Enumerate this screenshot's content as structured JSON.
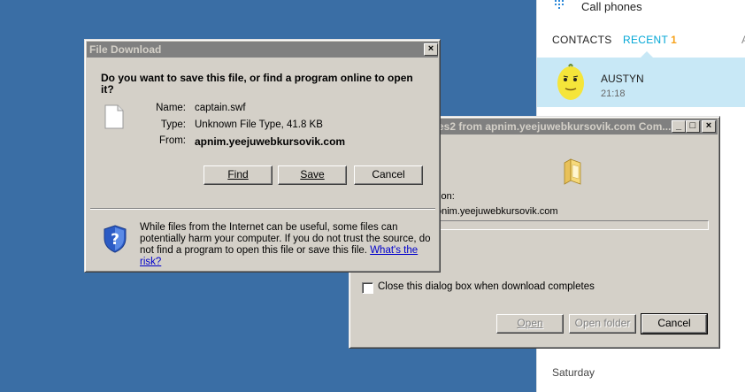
{
  "skype": {
    "call_label": "Call phones",
    "tabs": {
      "contacts": "CONTACTS",
      "recent": "RECENT",
      "recent_count": "1",
      "more": "A"
    },
    "contact": {
      "name": "AUSTYN",
      "time": "21:18"
    },
    "day_label": "Saturday",
    "colors": {
      "accent": "#00a6d6",
      "count": "#f7a21b",
      "selected_row": "#c8e8f6"
    }
  },
  "progress_dialog": {
    "title": "es2 from apnim.yeejuwebkursovik.com Com...",
    "location_label": "tion:",
    "location_value": "onim.yeejuwebkursovik.com",
    "close_checkbox_label": "Close this dialog box when download completes",
    "buttons": {
      "open": "Open",
      "open_folder": "Open folder",
      "cancel": "Cancel"
    }
  },
  "download_dialog": {
    "title": "File Download",
    "question": "Do you want to save this file, or find a program online to open it?",
    "name_label": "Name:",
    "name_value": "captain.swf",
    "type_label": "Type:",
    "type_value": "Unknown File Type, 41.8 KB",
    "from_label": "From:",
    "from_value": "apnim.yeejuwebkursovik.com",
    "buttons": {
      "find": "Find",
      "save": "Save",
      "cancel": "Cancel"
    },
    "warning_text": "While files from the Internet can be useful, some files can potentially harm your computer. If you do not trust the source, do not find a program to open this file or save this file.",
    "risk_link": "What's the risk?"
  },
  "icons": {
    "close": "close-icon",
    "minimize": "minimize-icon",
    "maximize": "maximize-icon",
    "folder": "folder-icon",
    "file": "file-icon",
    "shield": "shield-icon",
    "dialpad": "dialpad-icon",
    "avatar": "avatar"
  }
}
